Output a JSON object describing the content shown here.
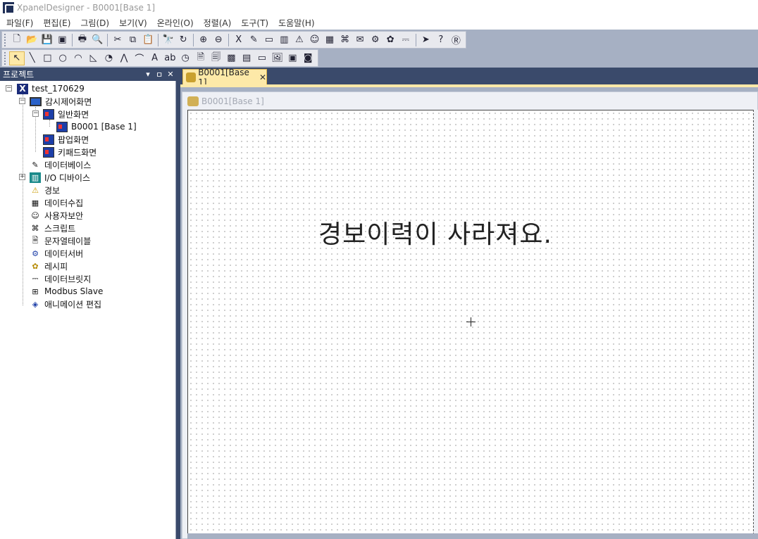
{
  "window": {
    "title": "XpanelDesigner - B0001[Base 1]"
  },
  "menu": [
    "파일(F)",
    "편집(E)",
    "그림(D)",
    "보기(V)",
    "온라인(O)",
    "정렬(A)",
    "도구(T)",
    "도움말(H)"
  ],
  "toolbar1": [
    {
      "icon": "new-file-icon",
      "glyph": "🗋"
    },
    {
      "icon": "open-folder-icon",
      "glyph": "📂"
    },
    {
      "icon": "save-icon",
      "glyph": "💾"
    },
    {
      "icon": "save-all-icon",
      "glyph": "▣"
    },
    {
      "sep": true
    },
    {
      "icon": "print-icon",
      "glyph": "🖶"
    },
    {
      "icon": "print-preview-icon",
      "glyph": "🔍"
    },
    {
      "sep": true
    },
    {
      "icon": "cut-icon",
      "glyph": "✂"
    },
    {
      "icon": "copy-icon",
      "glyph": "⧉"
    },
    {
      "icon": "paste-icon",
      "glyph": "📋"
    },
    {
      "sep": true
    },
    {
      "icon": "find-icon",
      "glyph": "🔭"
    },
    {
      "icon": "replace-icon",
      "glyph": "↻"
    },
    {
      "sep": true
    },
    {
      "icon": "zoom-in-icon",
      "glyph": "⊕"
    },
    {
      "icon": "zoom-out-icon",
      "glyph": "⊖"
    },
    {
      "sep": true
    },
    {
      "icon": "project-icon",
      "glyph": "X"
    },
    {
      "icon": "database-icon",
      "glyph": "✎"
    },
    {
      "icon": "screen-icon",
      "glyph": "▭"
    },
    {
      "icon": "io-device-icon",
      "glyph": "▥"
    },
    {
      "icon": "alarm-icon",
      "glyph": "⚠"
    },
    {
      "icon": "user-security-icon",
      "glyph": "☺"
    },
    {
      "icon": "data-collection-icon",
      "glyph": "▦"
    },
    {
      "icon": "script-icon",
      "glyph": "⌘"
    },
    {
      "icon": "string-table-icon",
      "glyph": "✉"
    },
    {
      "icon": "data-server-icon",
      "glyph": "⚙"
    },
    {
      "icon": "recipe-icon",
      "glyph": "✿"
    },
    {
      "icon": "data-bridge-icon",
      "glyph": "⎓"
    },
    {
      "sep": true
    },
    {
      "icon": "run-icon",
      "glyph": "➤"
    },
    {
      "icon": "help-icon",
      "glyph": "?"
    },
    {
      "icon": "about-icon",
      "glyph": "Ⓡ"
    }
  ],
  "toolbar2": [
    {
      "icon": "select-arrow-icon",
      "glyph": "↖"
    },
    {
      "icon": "line-icon",
      "glyph": "╲"
    },
    {
      "icon": "rectangle-icon",
      "glyph": "□"
    },
    {
      "icon": "ellipse-icon",
      "glyph": "○"
    },
    {
      "icon": "arc-icon",
      "glyph": "◠"
    },
    {
      "icon": "polygon-icon",
      "glyph": "◺"
    },
    {
      "icon": "pie-icon",
      "glyph": "◔"
    },
    {
      "icon": "polyline-icon",
      "glyph": "⋀"
    },
    {
      "icon": "freeform-icon",
      "glyph": "⌒"
    },
    {
      "icon": "text-icon",
      "glyph": "A"
    },
    {
      "icon": "label-icon",
      "glyph": "ab"
    },
    {
      "icon": "clock-icon",
      "glyph": "◷"
    },
    {
      "icon": "document-icon",
      "glyph": "🗎"
    },
    {
      "icon": "multi-document-icon",
      "glyph": "🗐"
    },
    {
      "icon": "chart-icon",
      "glyph": "▩"
    },
    {
      "icon": "table-icon",
      "glyph": "▤"
    },
    {
      "icon": "bar-icon",
      "glyph": "▭"
    },
    {
      "icon": "image-icon",
      "glyph": "🖼"
    },
    {
      "icon": "picture-icon",
      "glyph": "▣"
    },
    {
      "icon": "video-icon",
      "glyph": "◙"
    }
  ],
  "panel": {
    "title": "프로젝트",
    "pin": "ㅁ",
    "close": "✕",
    "dropdown": "▾"
  },
  "tree": {
    "root": "test_170629",
    "monitor": "감시제어화면",
    "normal": "일반화면",
    "b0001": "B0001 [Base 1]",
    "popup": "팝업화면",
    "keypad": "키패드화면",
    "database": "데이터베이스",
    "io": "I/O 디바이스",
    "alarm": "경보",
    "collect": "데이터수집",
    "security": "사용자보안",
    "script": "스크립트",
    "strings": "문자열테이블",
    "server": "데이터서버",
    "recipe": "레시피",
    "bridge": "데이터브릿지",
    "modbus": "Modbus Slave",
    "anim": "애니메이션 편집"
  },
  "doc": {
    "tab_label": "B0001[Base 1]",
    "tab_close": "✕",
    "child_caption": "B0001[Base 1]"
  },
  "canvas": {
    "text": "경보이력이 사라져요."
  }
}
